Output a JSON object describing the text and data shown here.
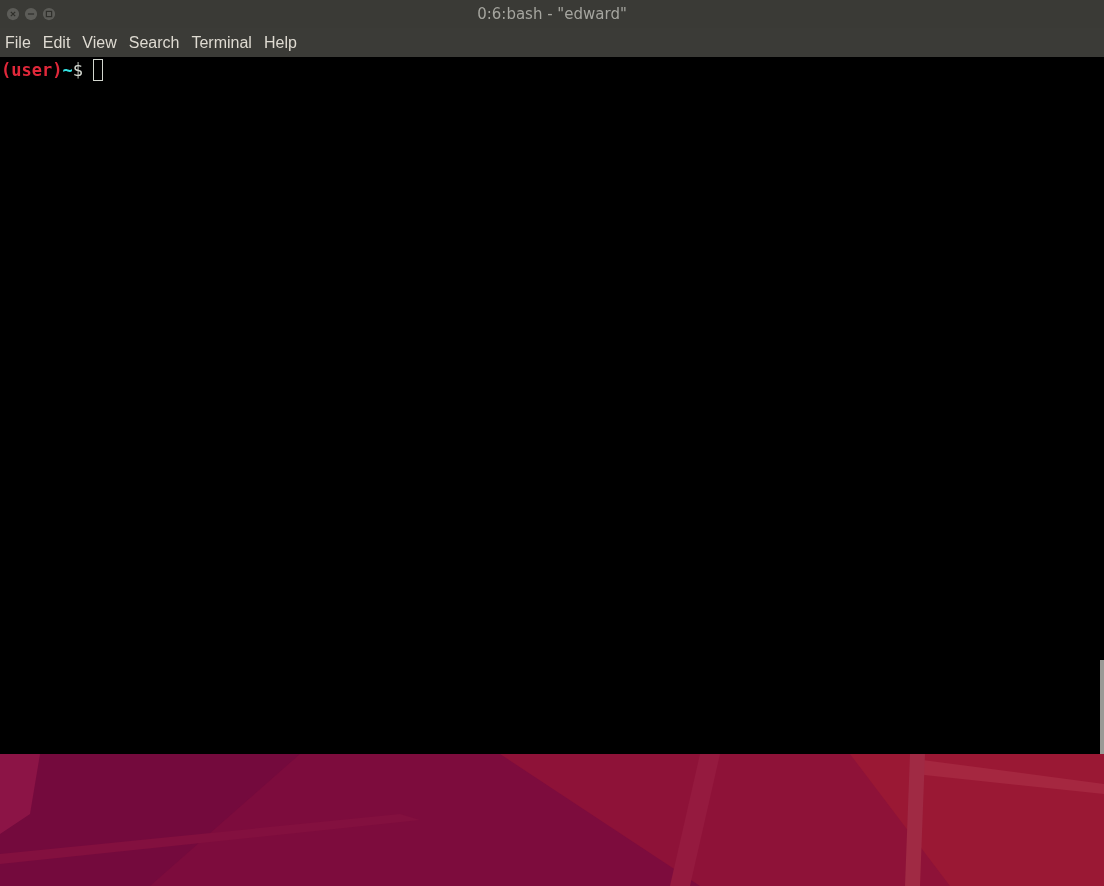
{
  "window": {
    "title": "0:6:bash - \"edward\""
  },
  "menu": [
    "File",
    "Edit",
    "View",
    "Search",
    "Terminal",
    "Help"
  ],
  "prompt": [
    {
      "kind": "env",
      "text": "(user)"
    },
    {
      "kind": "path",
      "text": "~"
    },
    {
      "kind": "sign",
      "text": "$"
    }
  ]
}
